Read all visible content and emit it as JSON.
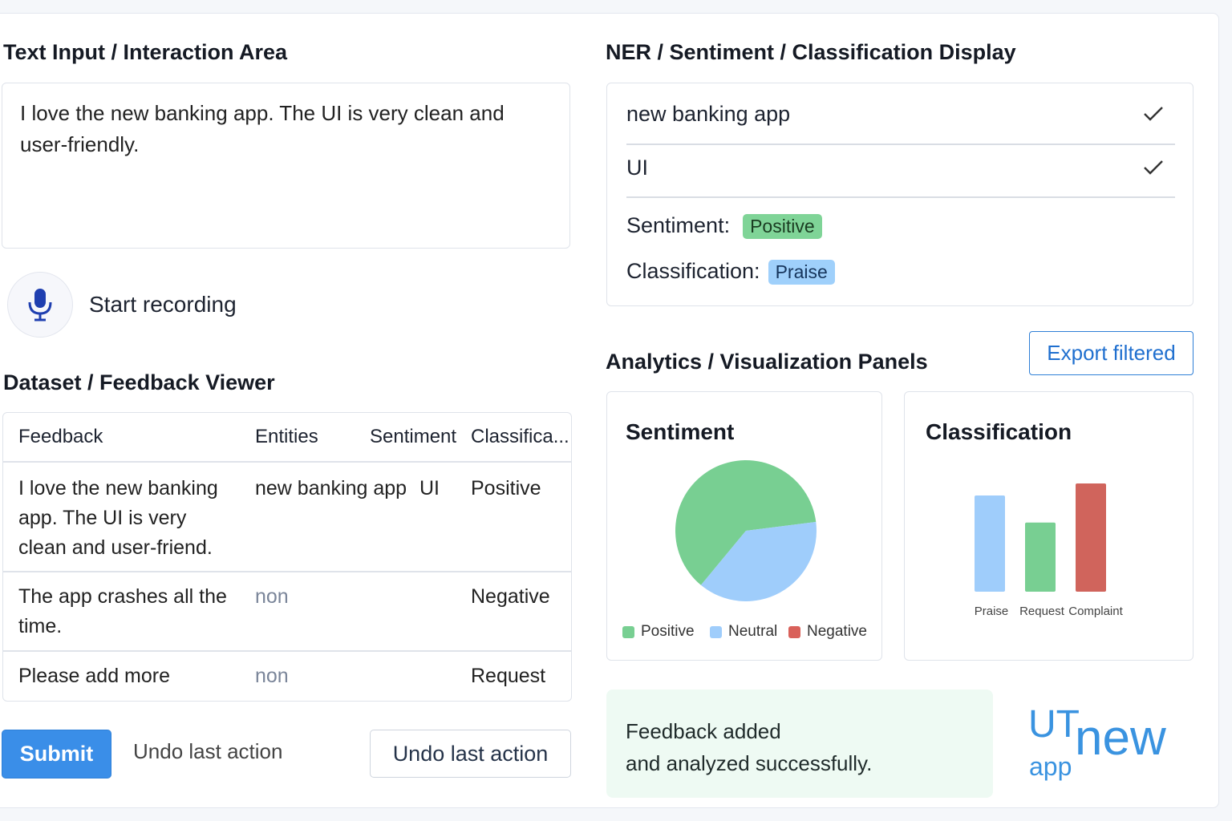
{
  "input_section": {
    "heading": "Text Input / Interaction Area",
    "textarea_value": "I love the new banking app. The UI is very clean and user-friendly.",
    "record_label": "Start recording"
  },
  "dataset_section": {
    "heading": "Dataset / Feedback Viewer",
    "columns": [
      "Feedback",
      "Entities",
      "Sentiment",
      "Classifica..."
    ],
    "rows": [
      {
        "feedback": "I love the new banking app. The UI is very clean and user-friend.",
        "entities_1": "new banking app",
        "entities_2": "UI",
        "sentiment": "Positive",
        "classification": ""
      },
      {
        "feedback": "The app crashes all the time.",
        "entities": "non",
        "sentiment": "",
        "classification": "Negative"
      },
      {
        "feedback": "Please add more",
        "entities": "non",
        "sentiment": "",
        "classification": "Request"
      }
    ]
  },
  "actions": {
    "submit_label": "Submit",
    "undo_text": "Undo last action",
    "undo_button_label": "Undo last action"
  },
  "ner_section": {
    "heading": "NER / Sentiment / Classification Display",
    "entities": [
      "new banking app",
      "UI"
    ],
    "sentiment_label": "Sentiment:",
    "sentiment_value": "Positive",
    "classification_label": "Classification:",
    "classification_value": "Praise"
  },
  "analytics_section": {
    "heading": "Analytics / Visualization Panels",
    "export_label": "Export filtered",
    "sentiment_panel_title": "Sentiment",
    "classification_panel_title": "Classification"
  },
  "chart_data": [
    {
      "type": "pie",
      "title": "Sentiment",
      "categories": [
        "Positive",
        "Neutral"
      ],
      "values": [
        0.62,
        0.38
      ],
      "legend": [
        "Positive",
        "Neutral",
        "Negative"
      ],
      "colors": {
        "Positive": "#78cf92",
        "Neutral": "#9fcdfb",
        "Negative": "#d9615a"
      },
      "legend_position": "bottom"
    },
    {
      "type": "bar",
      "title": "Classification",
      "categories": [
        "Praise",
        "Request",
        "Complaint"
      ],
      "values": [
        3.2,
        2.3,
        3.6
      ],
      "colors": [
        "#9fcdfb",
        "#78cf92",
        "#d0645c"
      ]
    }
  ],
  "toast": {
    "line1": "Feedback added",
    "line2": "and analyzed successfully."
  },
  "logo": {
    "part1": "UT",
    "part2": "new",
    "part3": "app"
  },
  "colors": {
    "accent": "#3a8ee8",
    "positive_badge_bg": "#7fd497",
    "praise_badge_bg": "#9fd0fb",
    "toast_bg": "#eefaf3"
  }
}
